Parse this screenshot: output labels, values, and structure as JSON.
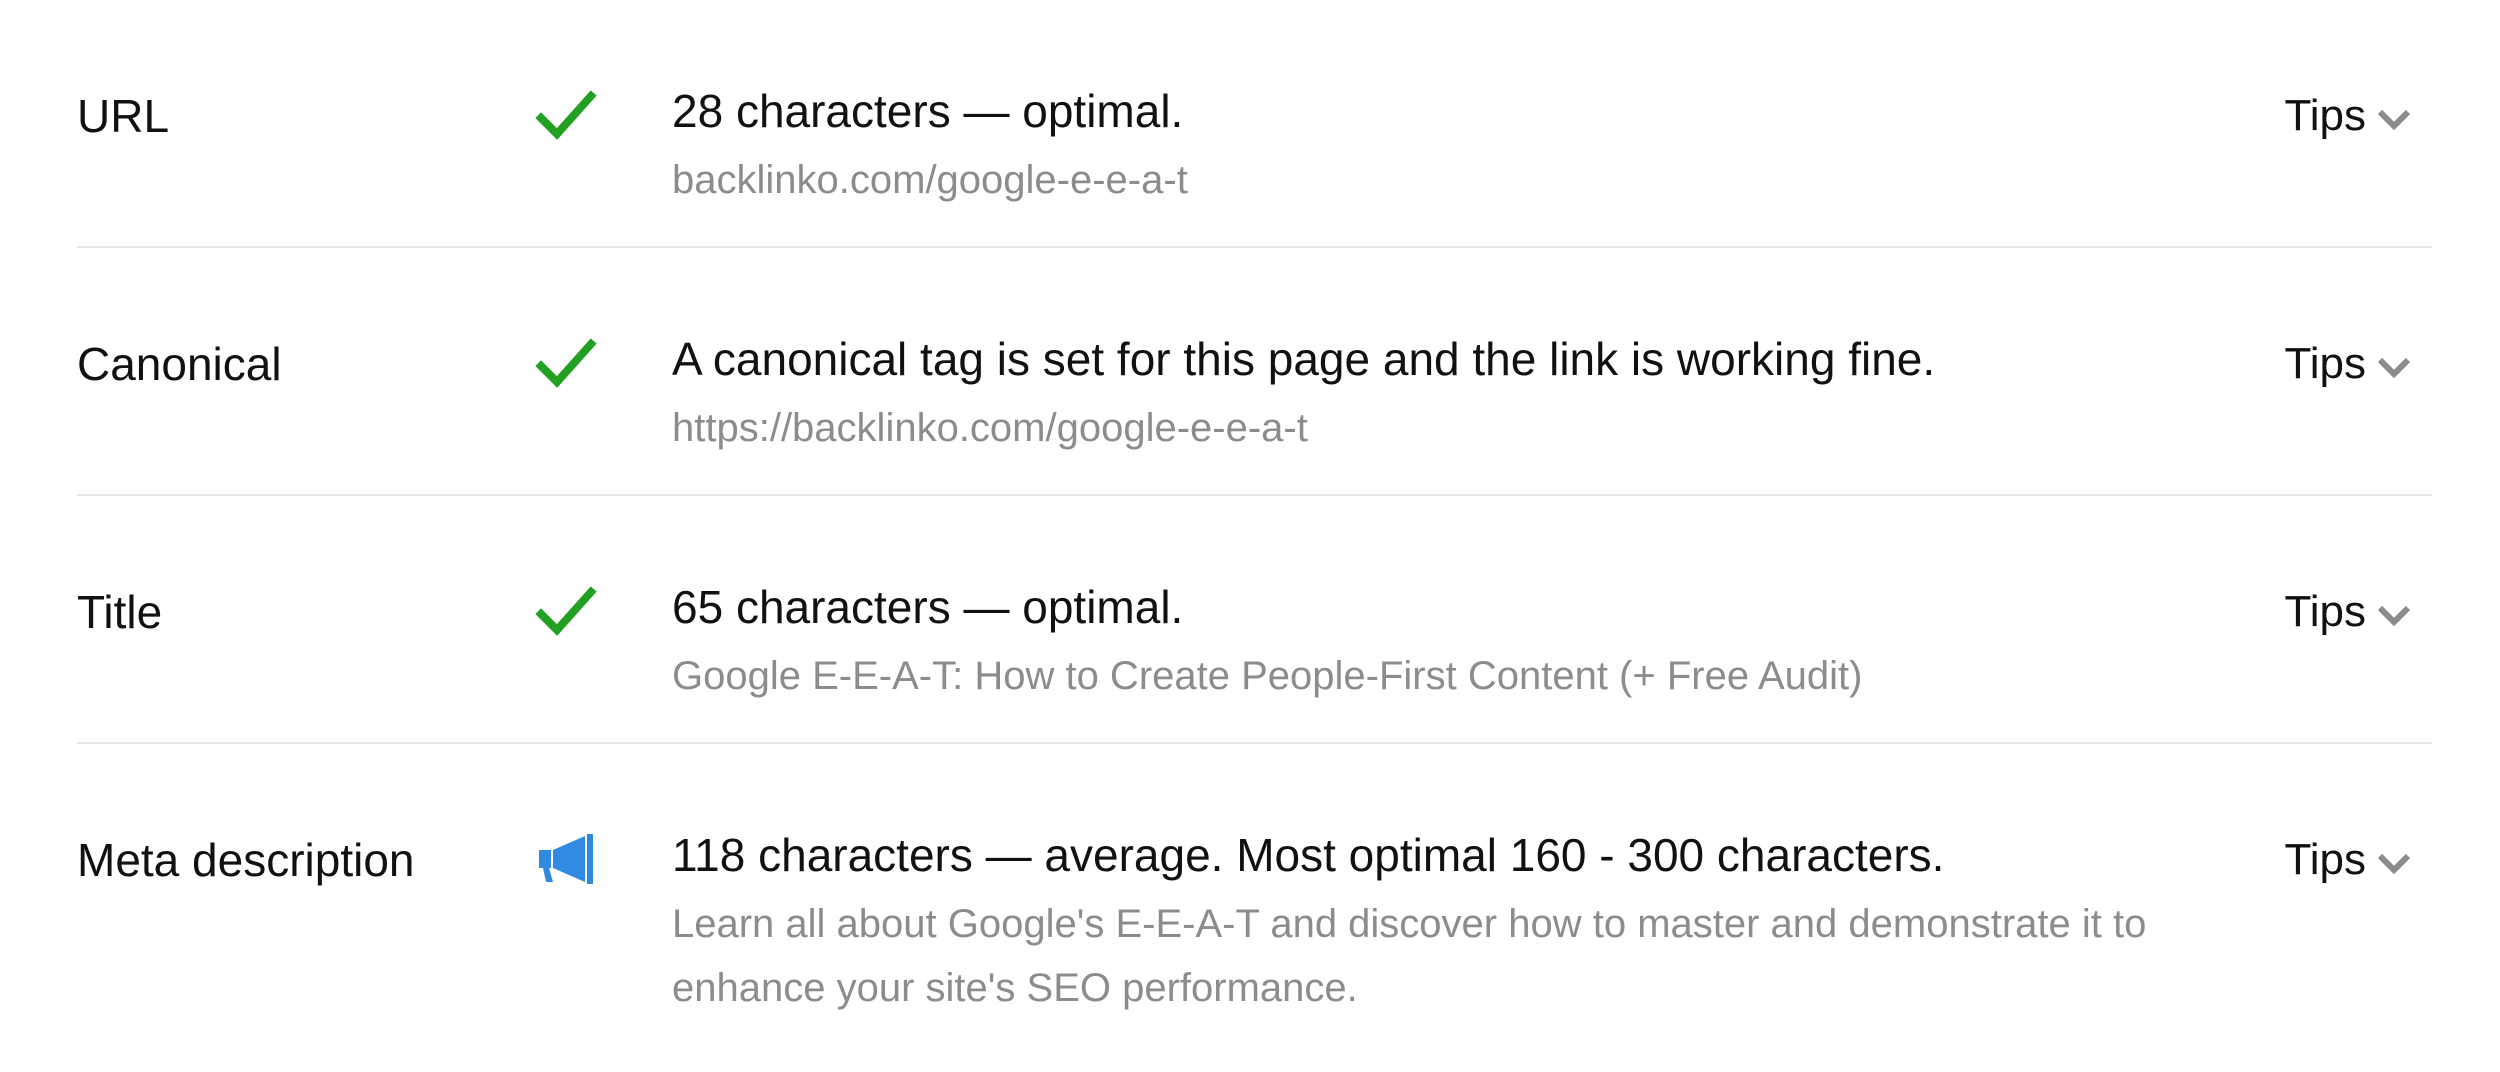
{
  "colors": {
    "check": "#22a022",
    "megaphone": "#2f8ae0",
    "secondary_text": "#8c8c8c",
    "divider": "#e6e6e6",
    "chevron": "#8c8c8c"
  },
  "rows": [
    {
      "label": "URL",
      "status_icon": "checkmark-icon",
      "headline": "28 characters — optimal.",
      "detail": "backlinko.com/google-e-e-a-t",
      "tips_label": "Tips"
    },
    {
      "label": "Canonical",
      "status_icon": "checkmark-icon",
      "headline": "A canonical tag is set for this page and the link is working fine.",
      "detail": "https://backlinko.com/google-e-e-a-t",
      "tips_label": "Tips"
    },
    {
      "label": "Title",
      "status_icon": "checkmark-icon",
      "headline": "65 characters — optimal.",
      "detail": "Google E-E-A-T: How to Create People-First Content (+ Free Audit)",
      "tips_label": "Tips"
    },
    {
      "label": "Meta description",
      "status_icon": "megaphone-icon",
      "headline": "118 characters — average. Most optimal 160 - 300 characters.",
      "detail": "Learn all about Google's E-E-A-T and discover how to master and demonstrate it to enhance your site's SEO performance.",
      "tips_label": "Tips"
    }
  ]
}
